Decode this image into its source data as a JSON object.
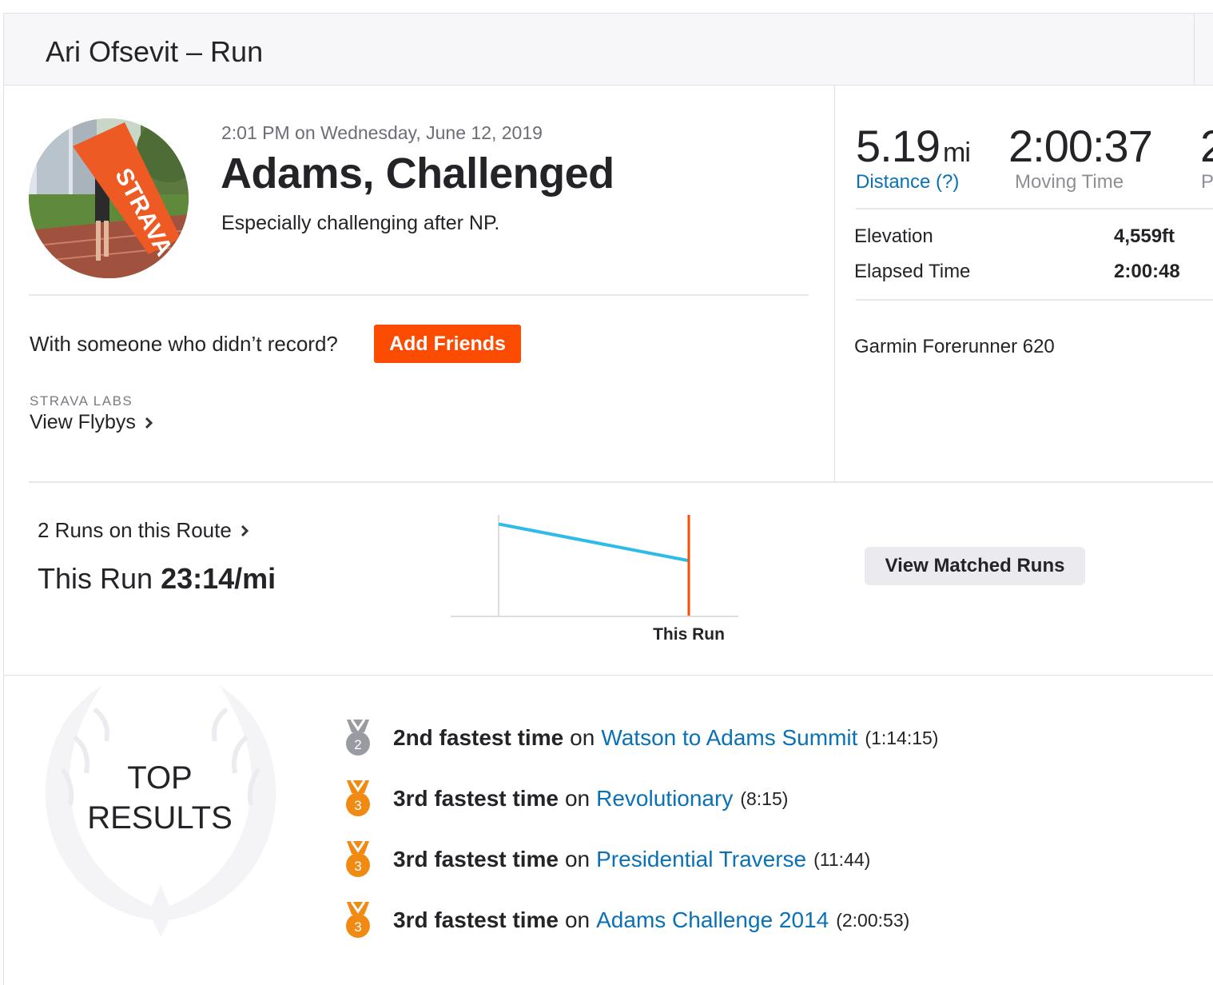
{
  "header": {
    "title": "Ari Ofsevit – Run"
  },
  "activity": {
    "timestamp": "2:01 PM on Wednesday, June 12, 2019",
    "name": "Adams, Challenged",
    "description": "Especially challenging after NP."
  },
  "friends": {
    "prompt": "With someone who didn’t record?",
    "button": "Add Friends"
  },
  "labs": {
    "label": "STRAVA LABS",
    "flybys": "View Flybys"
  },
  "stats": {
    "distance": {
      "value": "5.19",
      "unit": "mi",
      "label": "Distance (?)"
    },
    "moving_time": {
      "value": "2:00:37",
      "label": "Moving Time"
    },
    "pace": {
      "value": "2",
      "label": "P"
    },
    "elevation": {
      "label": "Elevation",
      "value": "4,559ft"
    },
    "elapsed": {
      "label": "Elapsed Time",
      "value": "2:00:48"
    },
    "device": "Garmin Forerunner 620"
  },
  "route": {
    "link": "2 Runs on this Route",
    "pace_prefix": "This Run",
    "pace_value": "23:14/mi",
    "button": "View Matched Runs"
  },
  "chart_data": {
    "type": "line",
    "x": [
      1,
      2
    ],
    "series": [
      {
        "values": [
          10,
          6
        ]
      }
    ],
    "ylim": [
      0,
      11
    ],
    "annotations": [
      "This Run"
    ],
    "highlight_x": 2,
    "colors": {
      "line": "#2ebbe8",
      "marker": "#fc4c02",
      "axis": "#dcdce2"
    }
  },
  "results": {
    "title_line1": "TOP",
    "title_line2": "RESULTS",
    "items": [
      {
        "medal": "2",
        "medal_type": "silver",
        "rank": "2nd fastest time",
        "on": "on",
        "segment": "Watson to Adams Summit",
        "time": "(1:14:15)"
      },
      {
        "medal": "3",
        "medal_type": "bronze",
        "rank": "3rd fastest time",
        "on": "on",
        "segment": "Revolutionary",
        "time": "(8:15)"
      },
      {
        "medal": "3",
        "medal_type": "bronze",
        "rank": "3rd fastest time",
        "on": "on",
        "segment": "Presidential Traverse",
        "time": "(11:44)"
      },
      {
        "medal": "3",
        "medal_type": "bronze",
        "rank": "3rd fastest time",
        "on": "on",
        "segment": "Adams Challenge 2014",
        "time": "(2:00:53)"
      }
    ]
  },
  "colors": {
    "brand": "#fc4c02",
    "link": "#0a71b6",
    "silver": "#9a9aa2",
    "bronze": "#f08a12"
  }
}
